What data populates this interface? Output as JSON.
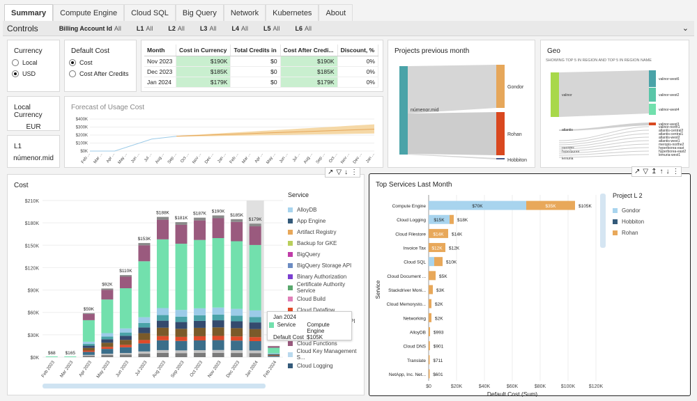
{
  "tabs": [
    "Summary",
    "Compute Engine",
    "Cloud SQL",
    "Big Query",
    "Network",
    "Kubernetes",
    "About"
  ],
  "controls": {
    "title": "Controls",
    "items": [
      {
        "label": "Billing Account Id",
        "value": "All"
      },
      {
        "label": "L1",
        "value": "All"
      },
      {
        "label": "L2",
        "value": "All"
      },
      {
        "label": "L3",
        "value": "All"
      },
      {
        "label": "L4",
        "value": "All"
      },
      {
        "label": "L5",
        "value": "All"
      },
      {
        "label": "L6",
        "value": "All"
      }
    ]
  },
  "currency": {
    "title": "Currency",
    "options": [
      "Local",
      "USD"
    ],
    "selected": "USD"
  },
  "default_cost": {
    "title": "Default Cost",
    "options": [
      "Cost",
      "Cost After Credits"
    ],
    "selected": "Cost"
  },
  "local_currency": {
    "title": "Local Currency",
    "value": "EUR"
  },
  "l1": {
    "title": "L1",
    "value": "númenor.mid"
  },
  "month_table": {
    "headers": [
      "Month",
      "Cost in Currency",
      "Total Credits in",
      "Cost After Credi...",
      "Discount, %"
    ],
    "rows": [
      [
        "Nov 2023",
        "$190K",
        "$0",
        "$190K",
        "0%"
      ],
      [
        "Dec 2023",
        "$185K",
        "$0",
        "$185K",
        "0%"
      ],
      [
        "Jan 2024",
        "$179K",
        "$0",
        "$179K",
        "0%"
      ]
    ]
  },
  "forecast": {
    "title": "Forecast of Usage Cost",
    "yticks": [
      "$400K",
      "$300K",
      "$200K",
      "$100K",
      "$0K"
    ],
    "xticks": [
      "Feb ...",
      "Mar ...",
      "Apr ...",
      "May ...",
      "Jun ...",
      "Jul ...",
      "Aug ...",
      "Sep ...",
      "Oct ...",
      "Nov ...",
      "Dec ...",
      "Jan ...",
      "Feb ...",
      "Mar ...",
      "Apr ...",
      "May ...",
      "Jun ...",
      "Jul ...",
      "Aug ...",
      "Sep ...",
      "Oct ...",
      "Nov ...",
      "Dec ...",
      "Jan ..."
    ]
  },
  "projects": {
    "title": "Projects previous month",
    "source": "númenor.mid",
    "targets": [
      "Gondor",
      "Rohan",
      "Hobbiton"
    ]
  },
  "geo": {
    "title": "Geo",
    "subtitle": "SHOWING TOP 5 IN REGION AND TOP 5 IN REGION NAME",
    "left": [
      "valinor",
      "atlantis",
      "meropis",
      "hyperborea",
      "lemuria"
    ],
    "right": [
      "valinor-west6",
      "valinor-west2",
      "valinor-west4",
      "valinor-west3",
      "valinor-north1",
      "atlantis-central2",
      "atlantis-central1",
      "atlantis-west2",
      "atlantis-west1",
      "meropis-northe2",
      "hyperborea-east",
      "hyperborea-east2",
      "lemuria-west1"
    ]
  },
  "cost": {
    "title": "Cost",
    "legend_title": "Service",
    "legend": [
      {
        "name": "AlloyDB",
        "color": "#a8d4ee"
      },
      {
        "name": "App Engine",
        "color": "#345a7a"
      },
      {
        "name": "Artifact Registry",
        "color": "#e8a85a"
      },
      {
        "name": "Backup for GKE",
        "color": "#b9cf5c"
      },
      {
        "name": "BigQuery",
        "color": "#c03ca8"
      },
      {
        "name": "BigQuery Storage API",
        "color": "#6c8cc2"
      },
      {
        "name": "Binary Authorization",
        "color": "#7b3fd0"
      },
      {
        "name": "Certificate Authority Service",
        "color": "#5aa86e"
      },
      {
        "name": "Cloud Build",
        "color": "#e07fb8"
      },
      {
        "name": "Cloud Dataflow",
        "color": "#e04a2a"
      },
      {
        "name": "Cloud Document AI API",
        "color": "#344a6e"
      },
      {
        "name": "Cloud Filestore",
        "color": "#7a5a2a"
      },
      {
        "name": "Cloud Functions",
        "color": "#9a5a7e"
      },
      {
        "name": "Cloud Key Management S...",
        "color": "#b9d9ee"
      },
      {
        "name": "Cloud Logging",
        "color": "#345a7a"
      }
    ],
    "tooltip": {
      "title": "Jan 2024",
      "k1": "Service",
      "v1": "Compute Engine",
      "k2": "Default Cost",
      "v2": "$105K"
    }
  },
  "chart_data": [
    {
      "type": "bar",
      "title": "Cost",
      "stacked": true,
      "categories": [
        "Feb 2023",
        "Mar 2023",
        "Apr 2023",
        "May 2023",
        "Jun 2023",
        "Jul 2023",
        "Aug 2023",
        "Sep 2023",
        "Oct 2023",
        "Nov 2023",
        "Dec 2023",
        "Jan 2024",
        "Feb 2024"
      ],
      "totals": [
        68,
        165,
        59000,
        92000,
        110000,
        153000,
        188000,
        181000,
        187000,
        190000,
        185000,
        179000,
        15000
      ],
      "total_labels": [
        "$68",
        "$165",
        "$59K",
        "$92K",
        "$110K",
        "$153K",
        "$188K",
        "$181K",
        "$187K",
        "$190K",
        "$185K",
        "$179K",
        ""
      ],
      "yticks": [
        "$210K",
        "$180K",
        "$150K",
        "$120K",
        "$90K",
        "$60K",
        "$30K",
        "$0K"
      ],
      "ylim": [
        0,
        210000
      ]
    },
    {
      "type": "bar",
      "title": "Top Services Last Month",
      "orientation": "horizontal",
      "stacked": true,
      "xlabel": "Default Cost (Sum)",
      "ylabel": "Service",
      "legend_title": "Project L 2",
      "series_names": [
        "Gondor",
        "Hobbiton",
        "Rohan"
      ],
      "categories": [
        "Compute Engine",
        "Cloud Logging",
        "Cloud Filestore",
        "Invoice Tax",
        "Cloud SQL",
        "Cloud Document ...",
        "Stackdriver Moni...",
        "Cloud Memorysto...",
        "Networking",
        "AlloyDB",
        "Cloud DNS",
        "Translate",
        "NetApp, Inc. Net..."
      ],
      "totals": [
        105000,
        18000,
        14000,
        12000,
        10000,
        5000,
        3000,
        2000,
        2000,
        993,
        901,
        711,
        601
      ],
      "total_labels": [
        "$105K",
        "$18K",
        "$14K",
        "$12K",
        "$10K",
        "$5K",
        "$3K",
        "$2K",
        "$2K",
        "$993",
        "$901",
        "$711",
        "$601"
      ],
      "gondor": [
        70000,
        15000,
        0,
        0,
        4000,
        0,
        0,
        0,
        0,
        0,
        0,
        0,
        0
      ],
      "rohan": [
        35000,
        3000,
        14000,
        12000,
        6000,
        5000,
        3000,
        2000,
        2000,
        993,
        901,
        711,
        601
      ],
      "segment_labels": [
        [
          "$70K",
          "$35K"
        ],
        [
          "$15K",
          ""
        ],
        [
          "",
          "$14K"
        ],
        [
          "",
          "$12K"
        ]
      ],
      "xticks": [
        "$0",
        "$20K",
        "$40K",
        "$60K",
        "$80K",
        "$100K",
        "$120K"
      ],
      "xlim": [
        0,
        120000
      ]
    }
  ],
  "top": {
    "title": "Top Services Last Month",
    "legend_title": "Project L 2",
    "legend": [
      {
        "name": "Gondor",
        "color": "#a8d4ee"
      },
      {
        "name": "Hobbiton",
        "color": "#345a7a"
      },
      {
        "name": "Rohan",
        "color": "#e8a85a"
      }
    ]
  }
}
